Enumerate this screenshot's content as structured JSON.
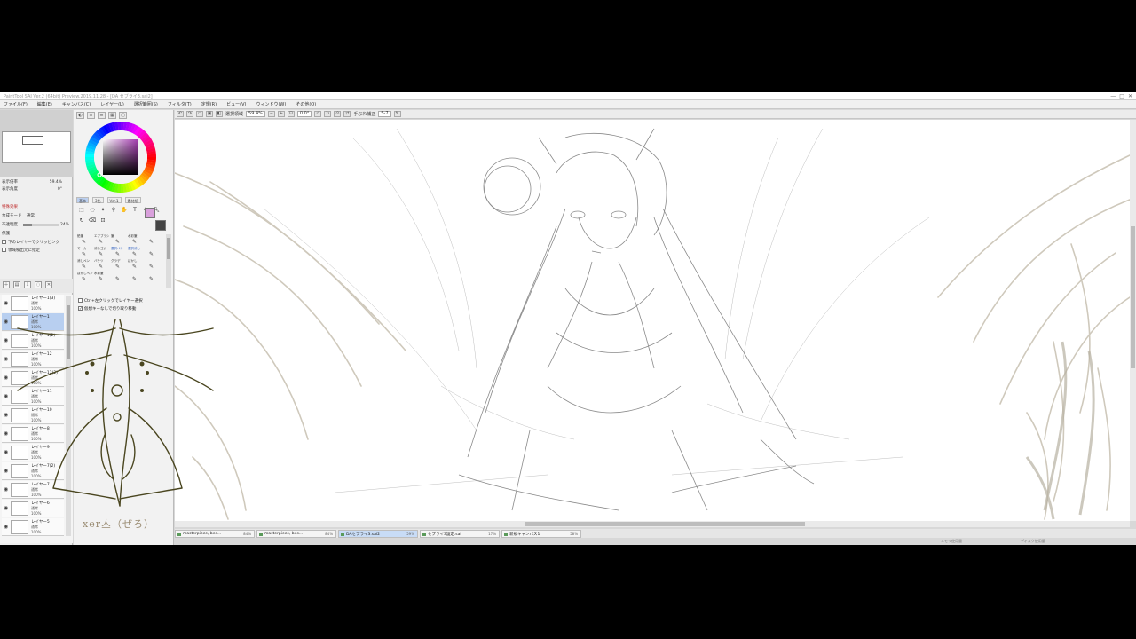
{
  "window": {
    "title": "PaintTool SAI Ver.2 (64bit) Preview.2019.11.28 - [DA セブライ3.sai2]",
    "buttons": [
      "—",
      "□",
      "✕"
    ]
  },
  "menu": [
    "ファイル(F)",
    "編集(E)",
    "キャンバス(C)",
    "レイヤー(L)",
    "選択範囲(S)",
    "フィルタ(T)",
    "定規(R)",
    "ビュー(V)",
    "ウィンドウ(W)",
    "その他(O)"
  ],
  "toolbar": {
    "selection_label": "選択領域",
    "zoom": "59.4%",
    "rotation": "0.0°",
    "stabilizer_label": "手ぶれ補正",
    "stabilizer_value": "S-7"
  },
  "navigator": {
    "zoom_label": "表示倍率",
    "zoom_value": "59.4%",
    "angle_label": "表示角度",
    "angle_value": "0°"
  },
  "layer_props": {
    "effects_label": "特殊効果",
    "blend_label": "合成モード",
    "blend_value": "通常",
    "opacity_label": "不透明度",
    "opacity_value": "24%",
    "opacity_fraction": 0.24,
    "protect_label": "保護",
    "clip_label": "下のレイヤーでクリッピング",
    "sel_source_label": "領域検出元に指定"
  },
  "layers": [
    {
      "name": "レイヤー1(3)",
      "mode": "通常",
      "opacity": "100%",
      "selected": false
    },
    {
      "name": "レイヤー1",
      "mode": "通常",
      "opacity": "100%",
      "selected": true
    },
    {
      "name": "レイヤー1(2)",
      "mode": "通常",
      "opacity": "100%",
      "selected": false
    },
    {
      "name": "レイヤー12",
      "mode": "通常",
      "opacity": "100%",
      "selected": false
    },
    {
      "name": "レイヤー12(2)",
      "mode": "通常",
      "opacity": "100%",
      "selected": false
    },
    {
      "name": "レイヤー11",
      "mode": "通常",
      "opacity": "100%",
      "selected": false
    },
    {
      "name": "レイヤー10",
      "mode": "通常",
      "opacity": "100%",
      "selected": false
    },
    {
      "name": "レイヤー8",
      "mode": "通常",
      "opacity": "100%",
      "selected": false
    },
    {
      "name": "レイヤー9",
      "mode": "通常",
      "opacity": "100%",
      "selected": false
    },
    {
      "name": "レイヤー7(2)",
      "mode": "通常",
      "opacity": "100%",
      "selected": false
    },
    {
      "name": "レイヤー7",
      "mode": "通常",
      "opacity": "100%",
      "selected": false
    },
    {
      "name": "レイヤー6",
      "mode": "通常",
      "opacity": "100%",
      "selected": false
    },
    {
      "name": "レイヤー5",
      "mode": "通常",
      "opacity": "100%",
      "selected": false
    }
  ],
  "color_tabs": [
    "基本",
    "3色",
    "Ver.1",
    "素材紙"
  ],
  "colors": {
    "primary": "#d9a0dc",
    "secondary": "#444444",
    "accent": "#3060c0"
  },
  "brushes": [
    {
      "label": "鉛筆",
      "active": false
    },
    {
      "label": "エアブラシ",
      "active": false
    },
    {
      "label": "筆",
      "active": false
    },
    {
      "label": "水彩筆",
      "active": false
    },
    {
      "label": "",
      "active": false
    },
    {
      "label": "マーカー",
      "active": false
    },
    {
      "label": "消しゴム",
      "active": false
    },
    {
      "label": "選択ペン",
      "active": true
    },
    {
      "label": "選択消し",
      "active": true
    },
    {
      "label": "",
      "active": false
    },
    {
      "label": "消しペン",
      "active": false
    },
    {
      "label": "バケツ",
      "active": false
    },
    {
      "label": "グラデ",
      "active": false
    },
    {
      "label": "ぼかし",
      "active": false
    },
    {
      "label": "",
      "active": false
    },
    {
      "label": "ぼかしペン",
      "active": false
    },
    {
      "label": "水彩筆",
      "active": false
    },
    {
      "label": "",
      "active": false
    },
    {
      "label": "",
      "active": false
    },
    {
      "label": "",
      "active": false
    }
  ],
  "tool_options": {
    "ctrl_click": "Ctrl+左クリックでレイヤー選択",
    "link_move": "仮想キーなしで切り取り移動"
  },
  "doc_tabs": [
    {
      "name": "masterpiece, bes...",
      "zoom": "84%",
      "active": false
    },
    {
      "name": "masterpiece, bes...",
      "zoom": "84%",
      "active": false
    },
    {
      "name": "DAセブライ3.sai2",
      "zoom": "59%",
      "active": true
    },
    {
      "name": "セブライ3設定.sai",
      "zoom": "17%",
      "active": false
    },
    {
      "name": "新規キャンバス1",
      "zoom": "58%",
      "active": false
    }
  ],
  "status": {
    "memory": "メモリ使用量",
    "disk": "ディスク使用量"
  },
  "signature": "xer亼（ぜろ）"
}
